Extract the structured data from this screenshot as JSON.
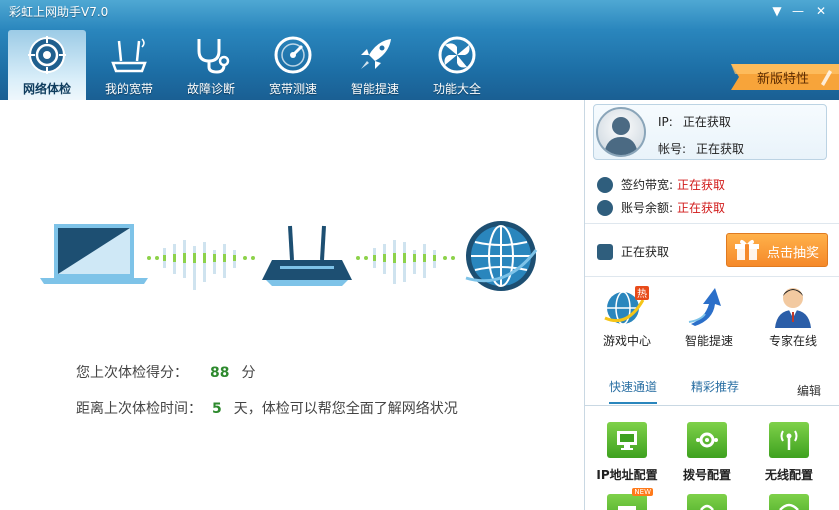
{
  "app": {
    "title": "彩虹上网助手V7.0"
  },
  "window_controls": {
    "menu": "▼",
    "minimize": "—",
    "close": "✕"
  },
  "nav": {
    "items": [
      {
        "label": "网络体检",
        "icon": "target-icon",
        "active": true
      },
      {
        "label": "我的宽带",
        "icon": "router-icon",
        "active": false
      },
      {
        "label": "故障诊断",
        "icon": "stethoscope-icon",
        "active": false
      },
      {
        "label": "宽带测速",
        "icon": "speedometer-icon",
        "active": false
      },
      {
        "label": "智能提速",
        "icon": "rocket-icon",
        "active": false
      },
      {
        "label": "功能大全",
        "icon": "puzzle-icon",
        "active": false
      }
    ],
    "new_feature_label": "新版特性"
  },
  "main": {
    "score_label": "您上次体检得分：",
    "score_value": "88",
    "score_unit": "分",
    "time_label": "距离上次体检时间：",
    "days_value": "5",
    "time_suffix": "天，体检可以帮您全面了解网络状况"
  },
  "sidebar": {
    "ip_label": "IP:",
    "ip_value": "正在获取",
    "account_label": "帐号:",
    "account_value": "正在获取",
    "bandwidth_label": "签约带宽:",
    "bandwidth_value": "正在获取",
    "balance_label": "账号余额:",
    "balance_value": "正在获取",
    "status_text": "正在获取",
    "lottery_label": "点击抽奖",
    "features": [
      {
        "label": "游戏中心",
        "icon": "game-globe-icon",
        "badge": "热"
      },
      {
        "label": "智能提速",
        "icon": "speed-arrow-icon"
      },
      {
        "label": "专家在线",
        "icon": "expert-icon"
      }
    ],
    "tabs": {
      "quick": "快速通道",
      "recommend": "精彩推荐",
      "edit": "编辑"
    },
    "tools": [
      {
        "label": "IP地址配置",
        "icon": "monitor-icon"
      },
      {
        "label": "拨号配置",
        "icon": "dial-icon"
      },
      {
        "label": "无线配置",
        "icon": "antenna-icon"
      }
    ],
    "new_badge": "NEW"
  },
  "colors": {
    "accent": "#2a86bd",
    "score_green": "#2e8a2e",
    "status_red": "#d11a1a",
    "orange": "#f5892a"
  }
}
